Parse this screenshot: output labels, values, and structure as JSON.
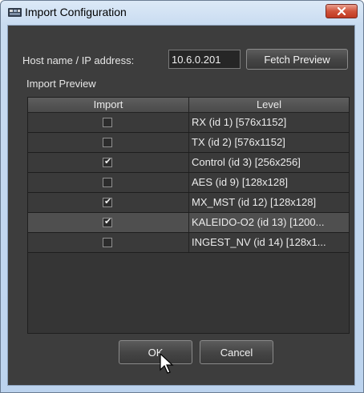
{
  "window": {
    "title": "Import Configuration",
    "close_icon": "close-x-icon"
  },
  "host": {
    "label": "Host name / IP address:",
    "value": "10.6.0.201",
    "fetch_label": "Fetch Preview"
  },
  "preview": {
    "section_label": "Import Preview",
    "columns": [
      "Import",
      "Level"
    ],
    "rows": [
      {
        "checked": false,
        "level": "RX (id 1) [576x1152]"
      },
      {
        "checked": false,
        "level": "TX (id 2) [576x1152]"
      },
      {
        "checked": true,
        "level": "Control (id 3) [256x256]"
      },
      {
        "checked": false,
        "level": "AES (id 9) [128x128]"
      },
      {
        "checked": true,
        "level": "MX_MST (id 12) [128x128]"
      },
      {
        "checked": true,
        "level": "KALEIDO-O2 (id 13) [1200..."
      },
      {
        "checked": false,
        "level": "INGEST_NV (id 14) [128x1..."
      }
    ],
    "selected_row": 5
  },
  "buttons": {
    "ok": "OK",
    "cancel": "Cancel"
  }
}
